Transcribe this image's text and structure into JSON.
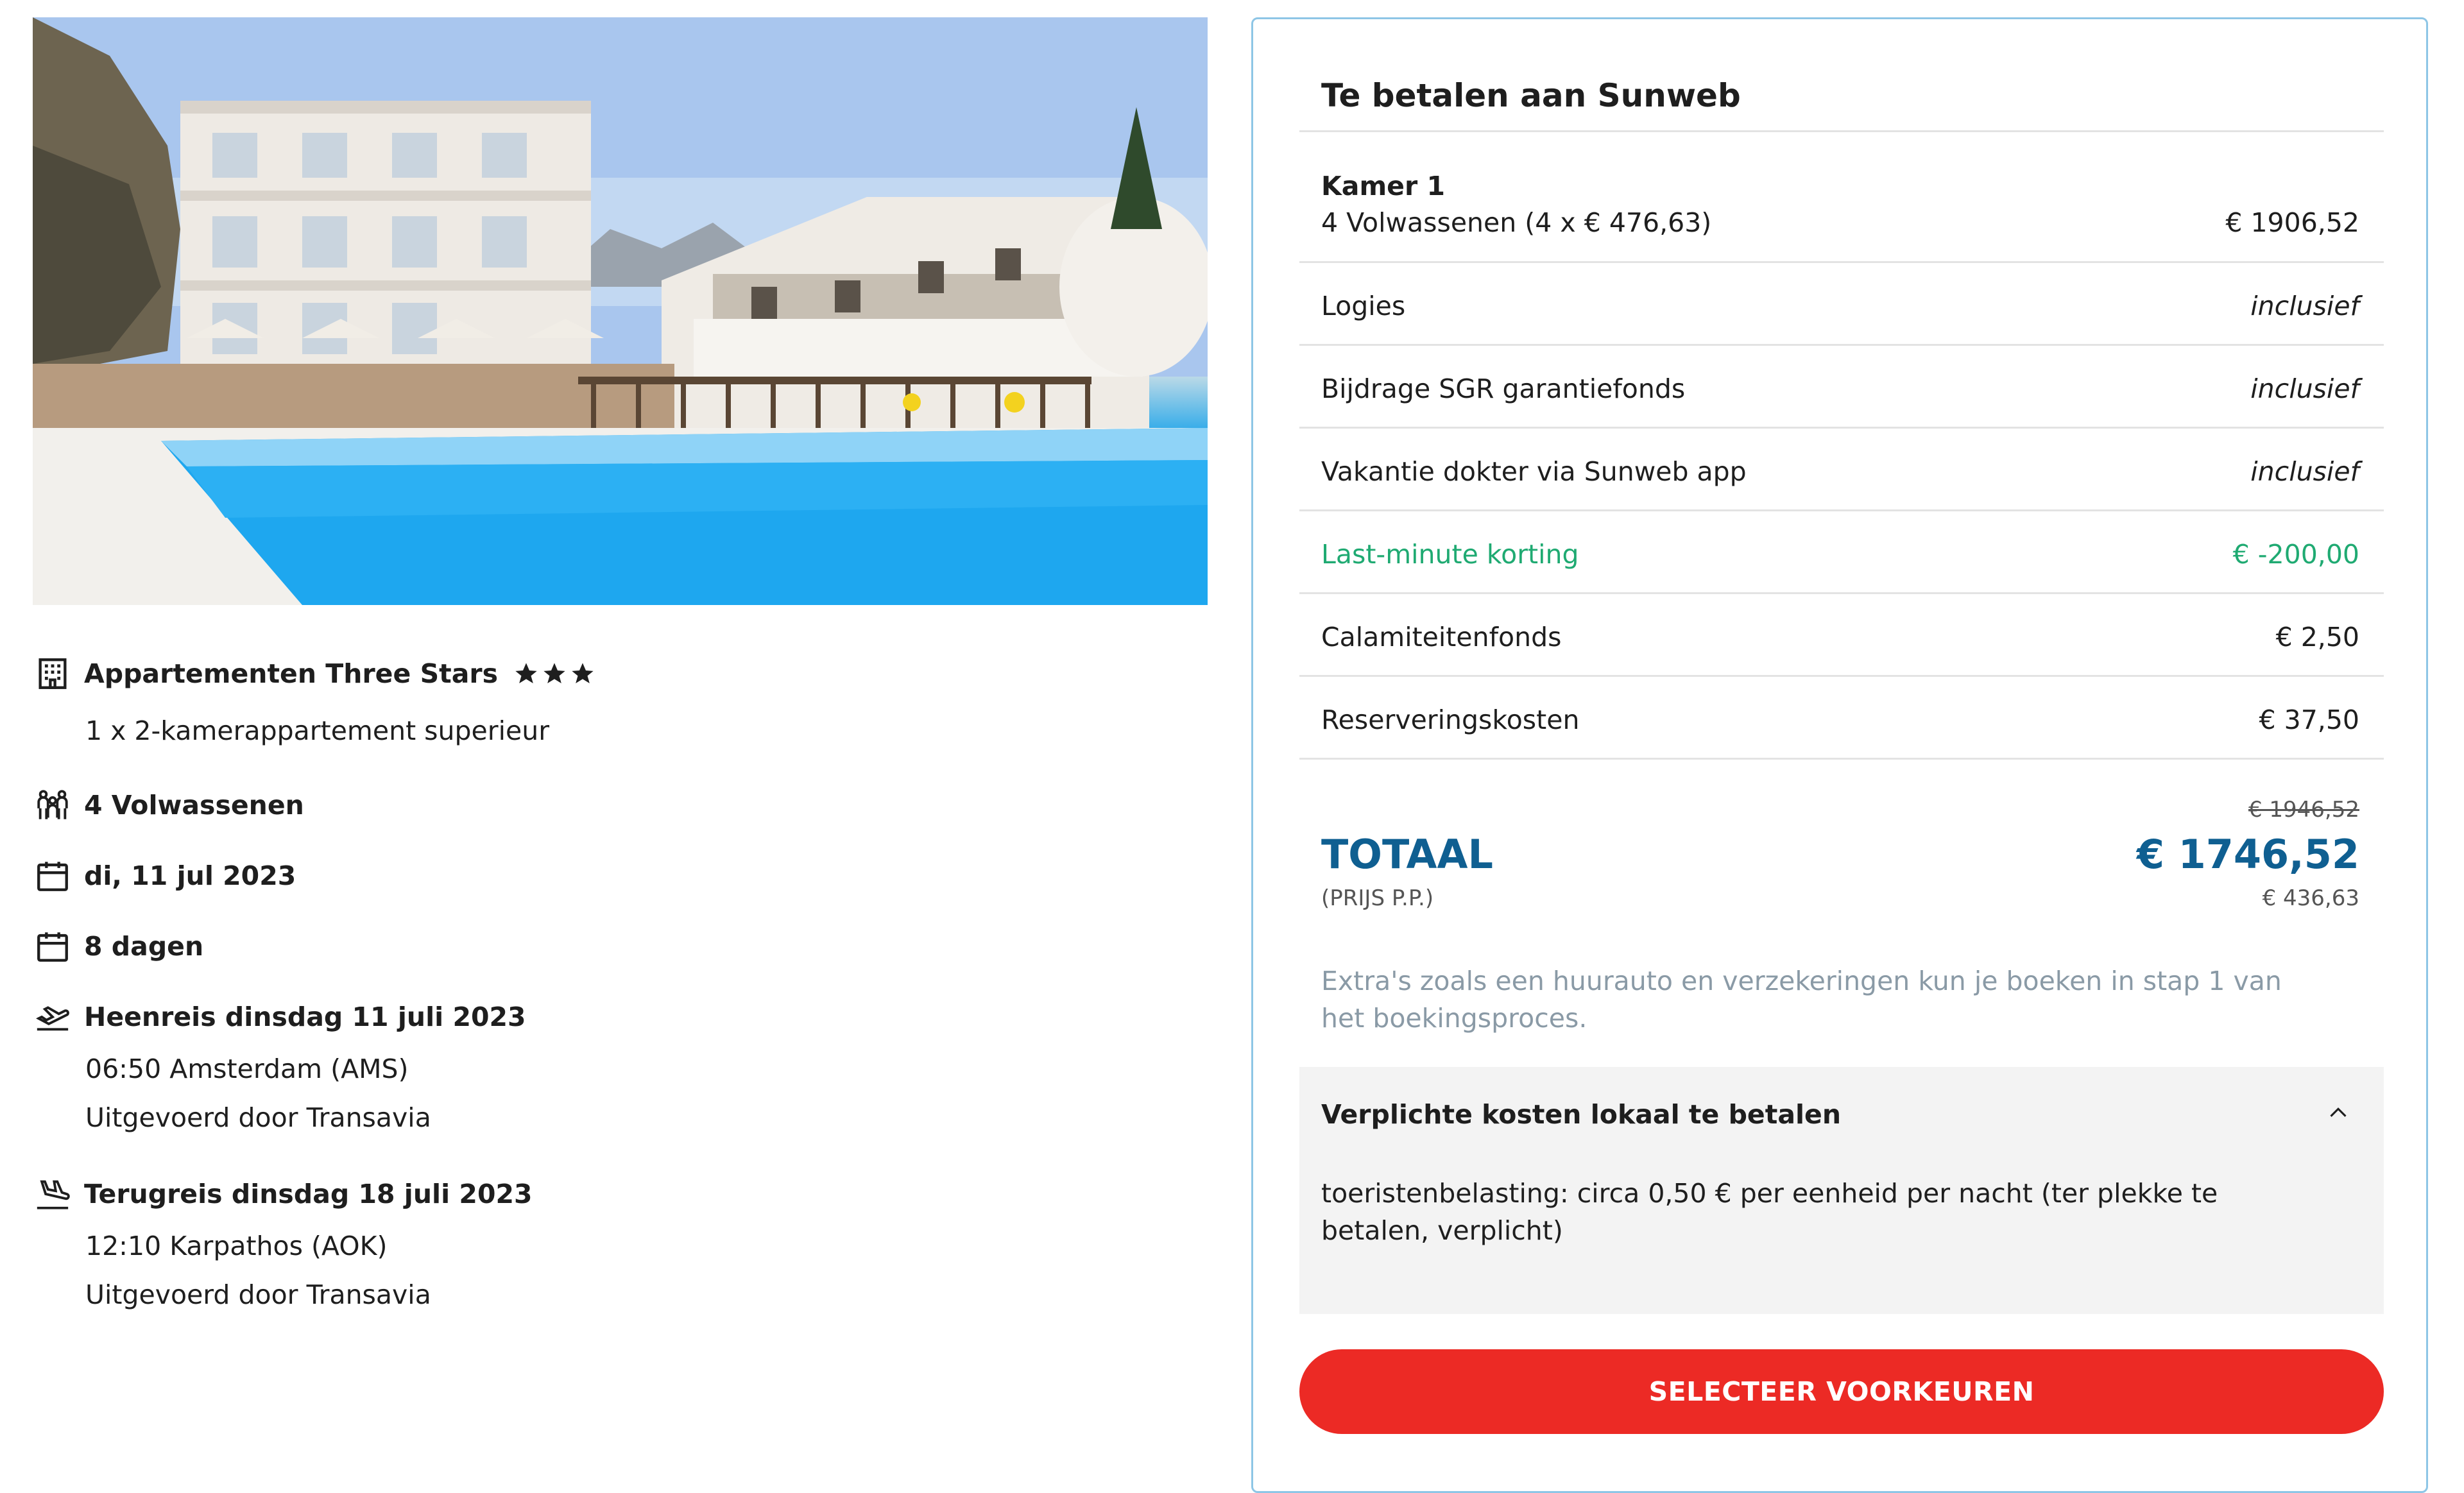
{
  "hotel": {
    "name": "Appartementen Three Stars",
    "stars": 3,
    "room": "1 x 2-kamerappartement superieur"
  },
  "travelers": "4 Volwassenen",
  "date": "di, 11 jul 2023",
  "duration": "8 dagen",
  "outbound": {
    "title": "Heenreis dinsdag 11 juli 2023",
    "time_place": "06:50 Amsterdam (AMS)",
    "carrier": "Uitgevoerd door Transavia"
  },
  "return": {
    "title": "Terugreis dinsdag 18 juli 2023",
    "time_place": "12:10 Karpathos (AOK)",
    "carrier": "Uitgevoerd door Transavia"
  },
  "payment": {
    "title": "Te betalen aan Sunweb",
    "room_label": "Kamer 1",
    "lines": [
      {
        "label": "4 Volwassenen (4 x € 476,63)",
        "value": "€ 1906,52"
      },
      {
        "label": "Logies",
        "value": "inclusief"
      },
      {
        "label": "Bijdrage SGR garantiefonds",
        "value": "inclusief"
      },
      {
        "label": "Vakantie dokter via Sunweb app",
        "value": "inclusief"
      },
      {
        "label": "Last-minute korting",
        "value": "€ -200,00"
      },
      {
        "label": "Calamiteitenfonds",
        "value": "€ 2,50"
      },
      {
        "label": "Reserveringskosten",
        "value": "€ 37,50"
      }
    ],
    "original_total": "€ 1946,52",
    "total_label": "TOTAAL",
    "total_value": "€ 1746,52",
    "per_person_label": "(PRIJS P.P.)",
    "per_person_value": "€ 436,63",
    "extras_note": "Extra's zoals een huurauto en verzekeringen kun je boeken in stap 1 van het boekingsproces.",
    "local_costs": {
      "title": "Verplichte kosten lokaal te betalen",
      "text": "toeristenbelasting: circa 0,50 € per eenheid per nacht (ter plekke te betalen, verplicht)"
    },
    "cta_label": "SELECTEER VOORKEUREN"
  },
  "colors": {
    "total_blue": "#0f5f91",
    "discount_green": "#1faa72",
    "cta_red": "#ec2a25",
    "note_grey": "#8a9aa6"
  },
  "icons": [
    "building-icon",
    "star-icon",
    "group-icon",
    "calendar-icon",
    "plane-departure-icon",
    "plane-arrival-icon",
    "chevron-up-icon"
  ]
}
